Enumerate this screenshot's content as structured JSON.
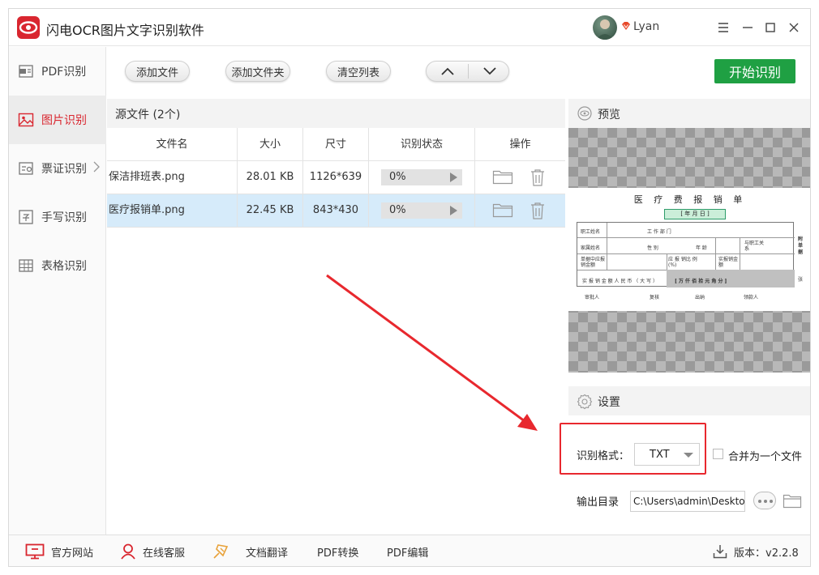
{
  "app": {
    "title": "闪电OCR图片文字识别软件",
    "user": "Lyan"
  },
  "sidebar": {
    "items": [
      {
        "label": "PDF识别"
      },
      {
        "label": "图片识别"
      },
      {
        "label": "票证识别"
      },
      {
        "label": "手写识别"
      },
      {
        "label": "表格识别"
      }
    ]
  },
  "toolbar": {
    "add_file": "添加文件",
    "add_folder": "添加文件夹",
    "clear_list": "清空列表",
    "start": "开始识别"
  },
  "files": {
    "header": "源文件 (2个)",
    "columns": [
      "文件名",
      "大小",
      "尺寸",
      "识别状态",
      "操作"
    ],
    "rows": [
      {
        "name": "保洁排班表.png",
        "size": "28.01 KB",
        "dims": "1126*639",
        "progress": "0%"
      },
      {
        "name": "医疗报销单.png",
        "size": "22.45 KB",
        "dims": "843*430",
        "progress": "0%"
      }
    ]
  },
  "preview": {
    "header": "预览",
    "doc": {
      "title": "医 疗 费 报 销 单",
      "date": "[ 年 月 日 ]",
      "labels": {
        "employee": "职工姓名",
        "dept": "工 作 部 门",
        "family": "家属姓名",
        "gender": "性 别",
        "age": "年 龄",
        "relation": "与职工关 系",
        "amount": "单据中应报销金额",
        "ratio": "应 报 销比 例(%)",
        "actual": "实报销金 额",
        "total": "实 报 销 金 额 人 民 币 （ 大 写 ）",
        "units": "[ 万 仟 佰 拾 元 角 分 ]",
        "approver": "审批人",
        "reviewer": "复核",
        "cashier": "出纳",
        "receiver": "领款人",
        "side1": "附单据",
        "side2": "张"
      }
    }
  },
  "settings": {
    "header": "设置",
    "format_label": "识别格式：",
    "format_value": "TXT",
    "merge_label": "合并为一个文件",
    "output_label": "输出目录",
    "output_path": "C:\\Users\\admin\\Desktop"
  },
  "footer": {
    "website": "官方网站",
    "support": "在线客服",
    "translate": "文档翻译",
    "pdf_convert": "PDF转换",
    "pdf_edit": "PDF编辑",
    "version": "版本：v2.2.8"
  }
}
